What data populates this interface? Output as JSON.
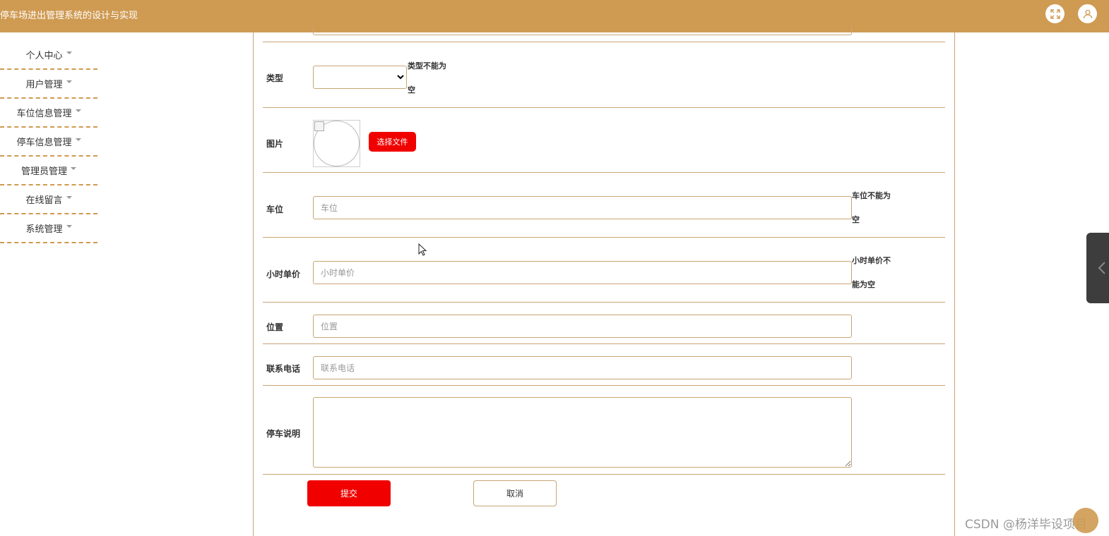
{
  "header": {
    "title": "停车场进出管理系统的设计与实现",
    "fullscreen_icon": "expand-icon",
    "user_icon": "user-icon"
  },
  "sidebar": {
    "items": [
      {
        "label": "个人中心"
      },
      {
        "label": "用户管理"
      },
      {
        "label": "车位信息管理"
      },
      {
        "label": "停车信息管理"
      },
      {
        "label": "管理员管理"
      },
      {
        "label": "在线留言"
      },
      {
        "label": "系统管理"
      }
    ]
  },
  "form": {
    "type": {
      "label": "类型",
      "error": "类型不能为空",
      "value": ""
    },
    "image": {
      "label": "图片",
      "upload_label": "选择文件"
    },
    "space": {
      "label": "车位",
      "placeholder": "车位",
      "error": "车位不能为空"
    },
    "hourly_price": {
      "label": "小时单价",
      "placeholder": "小时单价",
      "error": "小时单价不能为空"
    },
    "location": {
      "label": "位置",
      "placeholder": "位置"
    },
    "phone": {
      "label": "联系电话",
      "placeholder": "联系电话"
    },
    "description": {
      "label": "停车说明"
    },
    "submit_label": "提交",
    "cancel_label": "取消"
  },
  "watermark": "CSDN @杨洋毕设项目",
  "colors": {
    "brand": "#cf9a52",
    "primary_button": "#f10000",
    "border": "#c9a574"
  }
}
